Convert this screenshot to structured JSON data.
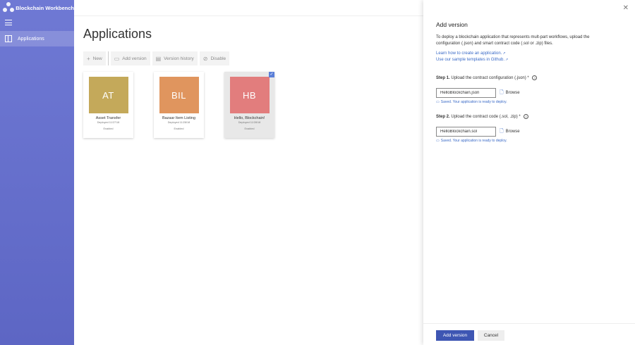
{
  "app": {
    "title": "Blockchain Workbench"
  },
  "nav": {
    "items": [
      {
        "label": "Applications",
        "icon": "applications-icon"
      }
    ]
  },
  "main": {
    "title": "Applications",
    "toolbar": {
      "new": "New",
      "add_version": "Add version",
      "version_history": "Version history",
      "disable": "Disable"
    },
    "cards": [
      {
        "initials": "AT",
        "name": "Asset Transfer",
        "deployed": "Deployed 11/27/18",
        "status": "Enabled",
        "color": "#c4a95a",
        "selected": false
      },
      {
        "initials": "BIL",
        "name": "Bazaar Item Listing",
        "deployed": "Deployed 11/28/18",
        "status": "Enabled",
        "color": "#e0955e",
        "selected": false
      },
      {
        "initials": "HB",
        "name": "Hello, Blockchain!",
        "deployed": "Deployed 11/28/18",
        "status": "Enabled",
        "color": "#e27d7d",
        "selected": true
      }
    ]
  },
  "panel": {
    "title": "Add version",
    "description": "To deploy a blockchain application that represents mult-part workflows, upload the configuration (.json) and smart contract code (.sol or .zip) files.",
    "link1": "Learn how to create an application.",
    "link2": "Use our sample templates in Github.",
    "step1": {
      "prefix": "Step 1.",
      "label": "Upload the contract configuration (.json) *",
      "value": "HelloBlockchain.json",
      "saved": "Saved. Your application is ready to deploy."
    },
    "step2": {
      "prefix": "Step 2.",
      "label": "Upload the contract code (.sol, .zip) *",
      "value": "HelloBlockchain.sol",
      "saved": "Saved. Your application is ready to deploy."
    },
    "browse": "Browse",
    "primary_button": "Add version",
    "cancel_button": "Cancel"
  },
  "colors": {
    "nav": "#6f79d4",
    "accent": "#3e56b3",
    "link": "#3a6ac7"
  }
}
